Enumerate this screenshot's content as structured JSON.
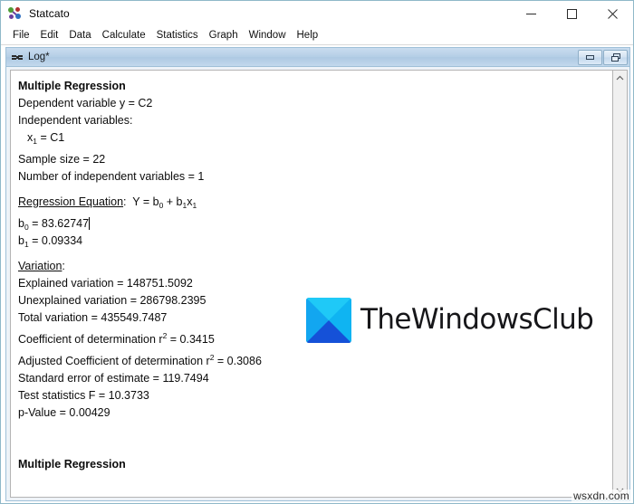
{
  "window": {
    "title": "Statcato",
    "app_icon": "statcato-molecule-icon",
    "controls": {
      "minimize": "minimize-icon",
      "maximize": "maximize-icon",
      "close": "close-icon"
    }
  },
  "menubar": {
    "items": [
      {
        "label": "File"
      },
      {
        "label": "Edit"
      },
      {
        "label": "Data"
      },
      {
        "label": "Calculate"
      },
      {
        "label": "Statistics"
      },
      {
        "label": "Graph"
      },
      {
        "label": "Window"
      },
      {
        "label": "Help"
      }
    ]
  },
  "child_window": {
    "title": "Log*",
    "icon": "log-document-icon",
    "buttons": {
      "minimize": "minimize-icon",
      "restore": "restore-icon"
    }
  },
  "log": {
    "heading": "Multiple Regression",
    "dependent_variable": "Dependent variable y = C2",
    "independent_variables_label": "Independent variables:",
    "independent_variable_1_prefix": "x",
    "independent_variable_1_sub": "1",
    "independent_variable_1_value": " = C1",
    "sample_size": "Sample size = 22",
    "num_independent_variables": "Number of independent variables = 1",
    "regression_equation_label": "Regression Equation",
    "regression_equation_colon": ":  Y = b",
    "eq_sub_0": "0",
    "eq_plus": " + b",
    "eq_sub_1a": "1",
    "eq_x": "x",
    "eq_sub_1b": "1",
    "b0_name": "b",
    "b0_sub": "0",
    "b0_value": " = 83.62747",
    "b1_name": "b",
    "b1_sub": "1",
    "b1_value": " = 0.09334",
    "variation_label": "Variation",
    "variation_colon": ":",
    "explained_variation": "Explained variation = 148751.5092",
    "unexplained_variation": "Unexplained variation = 286798.2395",
    "total_variation": "Total variation = 435549.7487",
    "coeff_det_prefix": "Coefficient of determination r",
    "coeff_det_sup": "2",
    "coeff_det_value": " = 0.3415",
    "adj_coeff_det_prefix": "Adjusted Coefficient of determination r",
    "adj_coeff_det_sup": "2",
    "adj_coeff_det_value": " = 0.3086",
    "standard_error": "Standard error of estimate = 119.7494",
    "test_statistic_f": "Test statistics F = 10.3733",
    "p_value": "p-Value = 0.00429",
    "footer_heading": "Multiple Regression"
  },
  "scrollbar": {
    "up_arrow": "chevron-up-icon",
    "down_arrow": "chevron-down-icon"
  },
  "watermarks": {
    "logo_text": "TheWindowsClub",
    "logo_mark": "thewindowsclub-x-square-icon",
    "site": "wsxdn.com"
  },
  "colors": {
    "child_titlebar": "#b5cfe6",
    "window_border": "#8fb8c9",
    "logo_cyan": "#1fc9f7",
    "logo_blue": "#1551d8"
  }
}
